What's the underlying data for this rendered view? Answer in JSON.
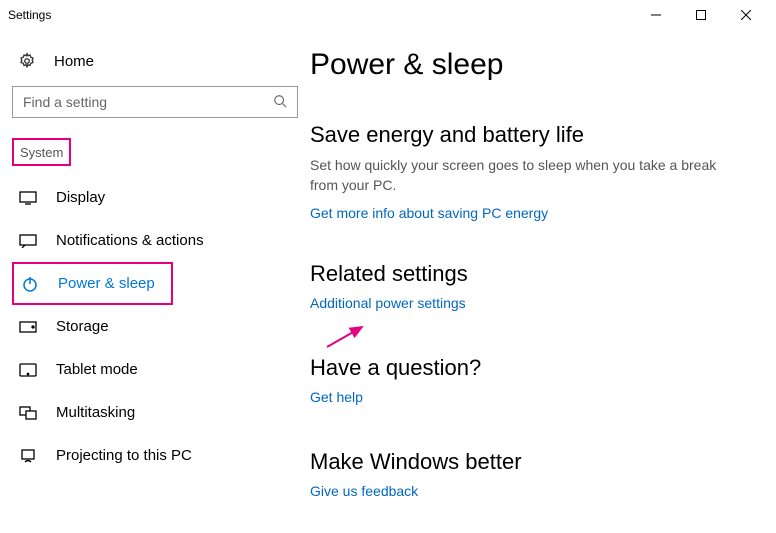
{
  "window": {
    "title": "Settings"
  },
  "sidebar": {
    "home_label": "Home",
    "search_placeholder": "Find a setting",
    "category_label": "System",
    "items": [
      {
        "label": "Display"
      },
      {
        "label": "Notifications & actions"
      },
      {
        "label": "Power & sleep"
      },
      {
        "label": "Storage"
      },
      {
        "label": "Tablet mode"
      },
      {
        "label": "Multitasking"
      },
      {
        "label": "Projecting to this PC"
      }
    ]
  },
  "main": {
    "page_title": "Power & sleep",
    "energy": {
      "heading": "Save energy and battery life",
      "desc": "Set how quickly your screen goes to sleep when you take a break from your PC.",
      "link": "Get more info about saving PC energy"
    },
    "related": {
      "heading": "Related settings",
      "link": "Additional power settings"
    },
    "question": {
      "heading": "Have a question?",
      "link": "Get help"
    },
    "better": {
      "heading": "Make Windows better",
      "link": "Give us feedback"
    }
  }
}
